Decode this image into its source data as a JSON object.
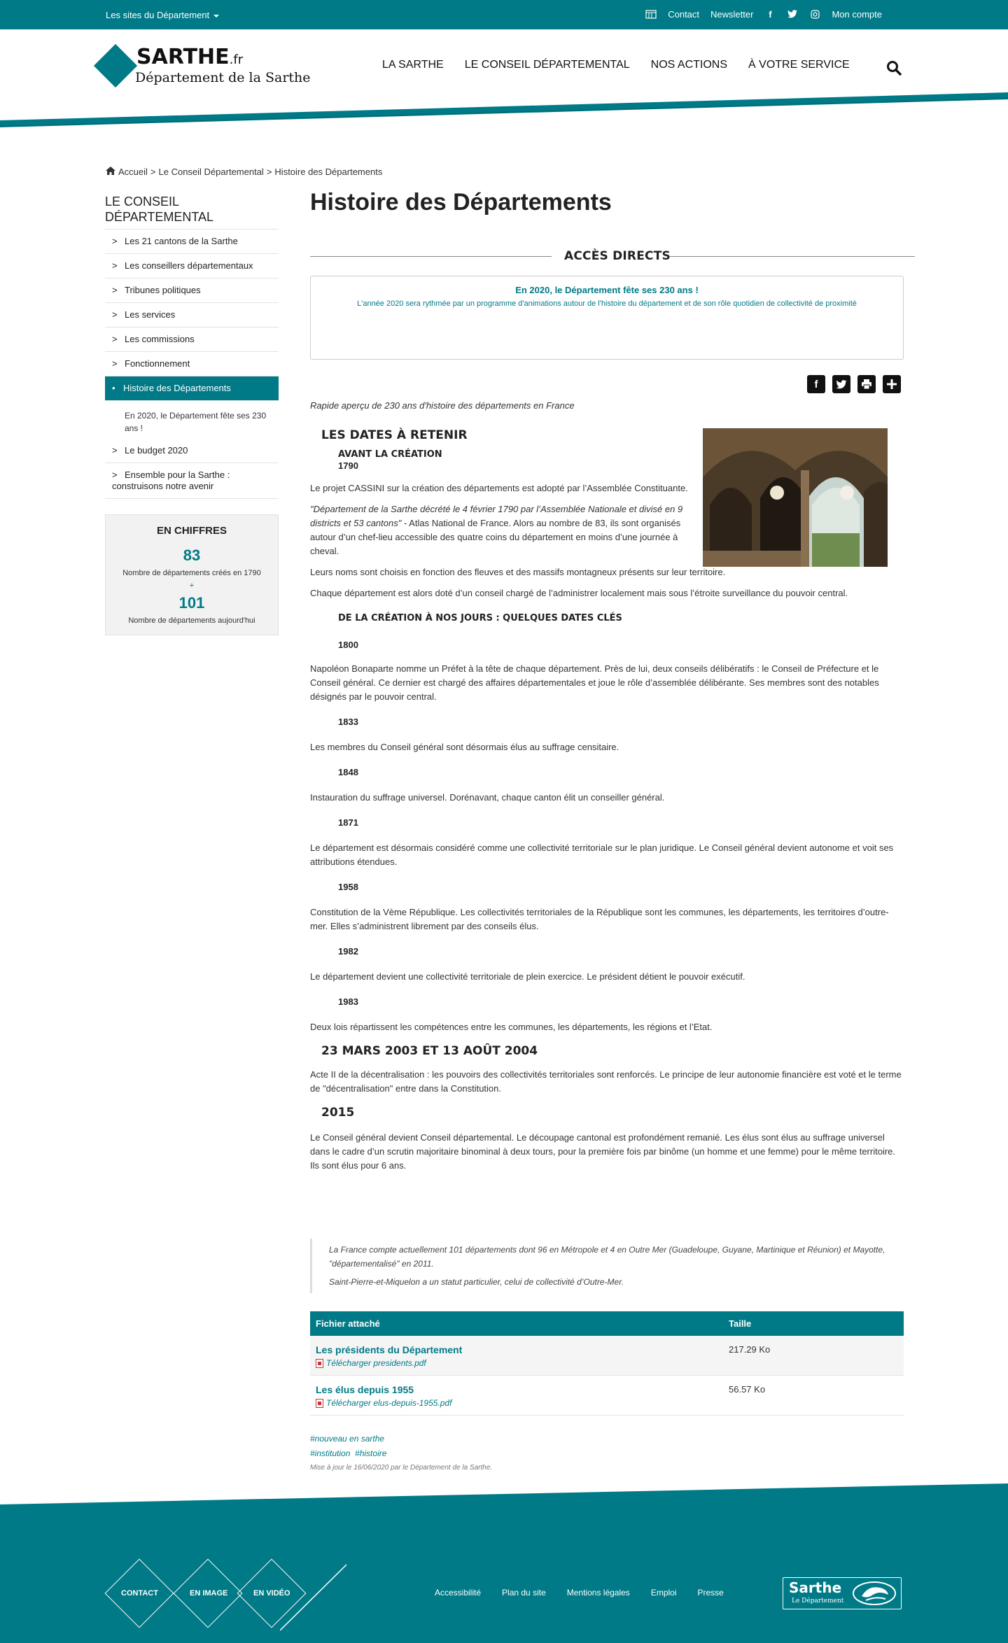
{
  "topbar": {
    "sites_label": "Les sites du Département",
    "contact": "Contact",
    "newsletter": "Newsletter",
    "account": "Mon compte"
  },
  "header": {
    "logo_brand": "SARTHE",
    "logo_tld": ".fr",
    "logo_subtitle": "Département de la Sarthe",
    "nav": [
      "LA SARTHE",
      "LE CONSEIL DÉPARTEMENTAL",
      "NOS ACTIONS",
      "À VOTRE SERVICE"
    ]
  },
  "breadcrumb": {
    "home": "Accueil",
    "sep": ">",
    "level1": "Le Conseil Départemental",
    "current": "Histoire des Départements"
  },
  "sidebar": {
    "title": "LE CONSEIL DÉPARTEMENTAL",
    "items": [
      "Les 21 cantons de la Sarthe",
      "Les conseillers départementaux",
      "Tribunes politiques",
      "Les services",
      "Les commissions",
      "Fonctionnement",
      "Histoire des Départements"
    ],
    "sub_item": "En 2020, le Département fête ses 230 ans !",
    "items_after": [
      "Le budget 2020",
      "Ensemble pour la Sarthe : construisons notre avenir"
    ],
    "figures": {
      "title": "EN CHIFFRES",
      "num1": "83",
      "label1": "Nombre de départements créés en 1790",
      "plus": "+",
      "num2": "101",
      "label2": "Nombre de départements aujourd'hui"
    }
  },
  "main": {
    "title": "Histoire des Départements",
    "acces_directs": "ACCÈS DIRECTS",
    "callout_title": "En 2020, le Département fête ses 230 ans !",
    "callout_text": "L'année 2020 sera rythmée par un programme d'animations autour de l'histoire du département et de son rôle quotidien de collectivité de proximité",
    "intro": "Rapide aperçu de 230 ans d'histoire des départements en France",
    "dates_heading": "LES DATES À RETENIR",
    "before_heading": "AVANT LA CRÉATION",
    "before_year": "1790",
    "p_cassini": "Le projet CASSINI sur la création des départements est adopté par l’Assemblée Constituante.",
    "p_quote_italic": "\"Département de la Sarthe décrété le 4 février 1790 par l’Assemblée Nationale et divisé en 9 districts et 53 cantons\"",
    "p_quote_rest": " - Atlas National de France. Alors au nombre de 83, ils sont organisés autour d’un chef-lieu accessible des quatre coins du département en moins d’une journée à cheval.",
    "p_names": "Leurs noms sont choisis en fonction des fleuves et des massifs montagneux présents sur leur territoire.",
    "p_council": "Chaque département est alors doté d’un conseil chargé de l’administrer localement mais sous l’étroite surveillance du pouvoir central.",
    "creation_heading": "DE LA CRÉATION À NOS JOURS : QUELQUES DATES CLÉS",
    "timeline": [
      {
        "year": "1800",
        "text": "Napoléon Bonaparte nomme un Préfet à la tête de chaque département. Près de lui, deux conseils délibératifs : le Conseil de Préfecture et le Conseil général. Ce dernier est chargé des affaires départementales et joue le rôle d’assemblée délibérante. Ses membres sont des notables désignés par le pouvoir central."
      },
      {
        "year": "1833",
        "text": "Les membres du Conseil général sont désormais élus au suffrage censitaire."
      },
      {
        "year": "1848",
        "text": "Instauration du suffrage universel. Dorénavant, chaque canton élit un conseiller général."
      },
      {
        "year": "1871",
        "text": "Le département est désormais considéré comme une collectivité territoriale sur le plan juridique. Le Conseil général devient autonome et voit ses attributions étendues."
      },
      {
        "year": "1958",
        "text": "Constitution de la Vème République. Les collectivités territoriales de la République sont les communes, les départements, les territoires d’outre-mer. Elles s’administrent librement par des conseils élus."
      },
      {
        "year": "1982",
        "text": "Le département devient une collectivité territoriale de plein exercice. Le président détient le pouvoir exécutif."
      },
      {
        "year": "1983",
        "text": "Deux lois répartissent les compétences entre les communes, les départements, les régions et l’Etat."
      }
    ],
    "h_2003": "23 MARS 2003 ET 13 AOÛT 2004",
    "p_2003": "Acte II de la décentralisation : les pouvoirs des collectivités territoriales sont renforcés. Le principe de leur autonomie financière est voté et le terme de \"décentralisation\" entre dans la Constitution.",
    "h_2015": "2015",
    "p_2015": "Le Conseil général devient Conseil départemental. Le découpage cantonal est profondément remanié. Les élus sont élus au suffrage universel dans le cadre d’un scrutin majoritaire binominal à deux tours, pour la première fois par binôme (un homme et une femme) pour le même territoire. Ils sont élus pour 6 ans.",
    "quote_1": "La France compte actuellement 101 départements dont 96 en Métropole et 4 en Outre Mer (Guadeloupe, Guyane, Martinique et Réunion) et Mayotte, \"départementalisé\" en 2011.",
    "quote_2": "Saint-Pierre-et-Miquelon a un statut particulier, celui de collectivité d’Outre-Mer.",
    "files": {
      "col_file": "Fichier attaché",
      "col_size": "Taille",
      "rows": [
        {
          "name": "Les présidents du Département",
          "link": "Télécharger presidents.pdf",
          "size": "217.29 Ko"
        },
        {
          "name": "Les élus depuis 1955",
          "link": "Télécharger elus-depuis-1955.pdf",
          "size": "56.57 Ko"
        }
      ]
    },
    "tags": [
      "#nouveau en sarthe",
      "#institution",
      "#histoire"
    ],
    "updated": "Mise à jour le 16/06/2020 par le Département de la Sarthe."
  },
  "footer": {
    "diamonds": [
      "CONTACT",
      "EN IMAGE",
      "EN VIDÉO"
    ],
    "links": [
      "Accessibilité",
      "Plan du site",
      "Mentions légales",
      "Emploi",
      "Presse"
    ],
    "logo_name": "Sarthe",
    "logo_sub": "Le Département"
  },
  "colors": {
    "accent": "#007a87"
  }
}
